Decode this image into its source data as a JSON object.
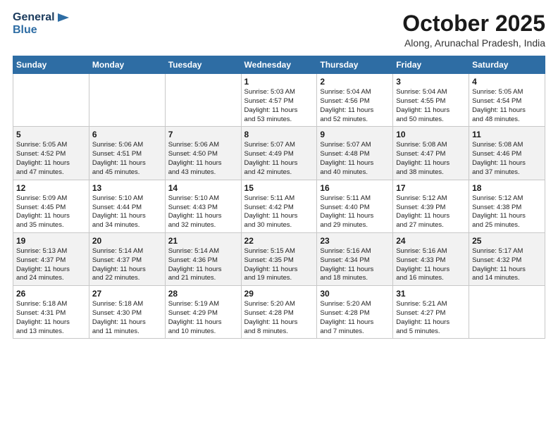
{
  "header": {
    "logo_line1": "General",
    "logo_line2": "Blue",
    "month": "October 2025",
    "location": "Along, Arunachal Pradesh, India"
  },
  "weekdays": [
    "Sunday",
    "Monday",
    "Tuesday",
    "Wednesday",
    "Thursday",
    "Friday",
    "Saturday"
  ],
  "weeks": [
    [
      {
        "day": "",
        "info": ""
      },
      {
        "day": "",
        "info": ""
      },
      {
        "day": "",
        "info": ""
      },
      {
        "day": "1",
        "info": "Sunrise: 5:03 AM\nSunset: 4:57 PM\nDaylight: 11 hours\nand 53 minutes."
      },
      {
        "day": "2",
        "info": "Sunrise: 5:04 AM\nSunset: 4:56 PM\nDaylight: 11 hours\nand 52 minutes."
      },
      {
        "day": "3",
        "info": "Sunrise: 5:04 AM\nSunset: 4:55 PM\nDaylight: 11 hours\nand 50 minutes."
      },
      {
        "day": "4",
        "info": "Sunrise: 5:05 AM\nSunset: 4:54 PM\nDaylight: 11 hours\nand 48 minutes."
      }
    ],
    [
      {
        "day": "5",
        "info": "Sunrise: 5:05 AM\nSunset: 4:52 PM\nDaylight: 11 hours\nand 47 minutes."
      },
      {
        "day": "6",
        "info": "Sunrise: 5:06 AM\nSunset: 4:51 PM\nDaylight: 11 hours\nand 45 minutes."
      },
      {
        "day": "7",
        "info": "Sunrise: 5:06 AM\nSunset: 4:50 PM\nDaylight: 11 hours\nand 43 minutes."
      },
      {
        "day": "8",
        "info": "Sunrise: 5:07 AM\nSunset: 4:49 PM\nDaylight: 11 hours\nand 42 minutes."
      },
      {
        "day": "9",
        "info": "Sunrise: 5:07 AM\nSunset: 4:48 PM\nDaylight: 11 hours\nand 40 minutes."
      },
      {
        "day": "10",
        "info": "Sunrise: 5:08 AM\nSunset: 4:47 PM\nDaylight: 11 hours\nand 38 minutes."
      },
      {
        "day": "11",
        "info": "Sunrise: 5:08 AM\nSunset: 4:46 PM\nDaylight: 11 hours\nand 37 minutes."
      }
    ],
    [
      {
        "day": "12",
        "info": "Sunrise: 5:09 AM\nSunset: 4:45 PM\nDaylight: 11 hours\nand 35 minutes."
      },
      {
        "day": "13",
        "info": "Sunrise: 5:10 AM\nSunset: 4:44 PM\nDaylight: 11 hours\nand 34 minutes."
      },
      {
        "day": "14",
        "info": "Sunrise: 5:10 AM\nSunset: 4:43 PM\nDaylight: 11 hours\nand 32 minutes."
      },
      {
        "day": "15",
        "info": "Sunrise: 5:11 AM\nSunset: 4:42 PM\nDaylight: 11 hours\nand 30 minutes."
      },
      {
        "day": "16",
        "info": "Sunrise: 5:11 AM\nSunset: 4:40 PM\nDaylight: 11 hours\nand 29 minutes."
      },
      {
        "day": "17",
        "info": "Sunrise: 5:12 AM\nSunset: 4:39 PM\nDaylight: 11 hours\nand 27 minutes."
      },
      {
        "day": "18",
        "info": "Sunrise: 5:12 AM\nSunset: 4:38 PM\nDaylight: 11 hours\nand 25 minutes."
      }
    ],
    [
      {
        "day": "19",
        "info": "Sunrise: 5:13 AM\nSunset: 4:37 PM\nDaylight: 11 hours\nand 24 minutes."
      },
      {
        "day": "20",
        "info": "Sunrise: 5:14 AM\nSunset: 4:37 PM\nDaylight: 11 hours\nand 22 minutes."
      },
      {
        "day": "21",
        "info": "Sunrise: 5:14 AM\nSunset: 4:36 PM\nDaylight: 11 hours\nand 21 minutes."
      },
      {
        "day": "22",
        "info": "Sunrise: 5:15 AM\nSunset: 4:35 PM\nDaylight: 11 hours\nand 19 minutes."
      },
      {
        "day": "23",
        "info": "Sunrise: 5:16 AM\nSunset: 4:34 PM\nDaylight: 11 hours\nand 18 minutes."
      },
      {
        "day": "24",
        "info": "Sunrise: 5:16 AM\nSunset: 4:33 PM\nDaylight: 11 hours\nand 16 minutes."
      },
      {
        "day": "25",
        "info": "Sunrise: 5:17 AM\nSunset: 4:32 PM\nDaylight: 11 hours\nand 14 minutes."
      }
    ],
    [
      {
        "day": "26",
        "info": "Sunrise: 5:18 AM\nSunset: 4:31 PM\nDaylight: 11 hours\nand 13 minutes."
      },
      {
        "day": "27",
        "info": "Sunrise: 5:18 AM\nSunset: 4:30 PM\nDaylight: 11 hours\nand 11 minutes."
      },
      {
        "day": "28",
        "info": "Sunrise: 5:19 AM\nSunset: 4:29 PM\nDaylight: 11 hours\nand 10 minutes."
      },
      {
        "day": "29",
        "info": "Sunrise: 5:20 AM\nSunset: 4:28 PM\nDaylight: 11 hours\nand 8 minutes."
      },
      {
        "day": "30",
        "info": "Sunrise: 5:20 AM\nSunset: 4:28 PM\nDaylight: 11 hours\nand 7 minutes."
      },
      {
        "day": "31",
        "info": "Sunrise: 5:21 AM\nSunset: 4:27 PM\nDaylight: 11 hours\nand 5 minutes."
      },
      {
        "day": "",
        "info": ""
      }
    ]
  ]
}
